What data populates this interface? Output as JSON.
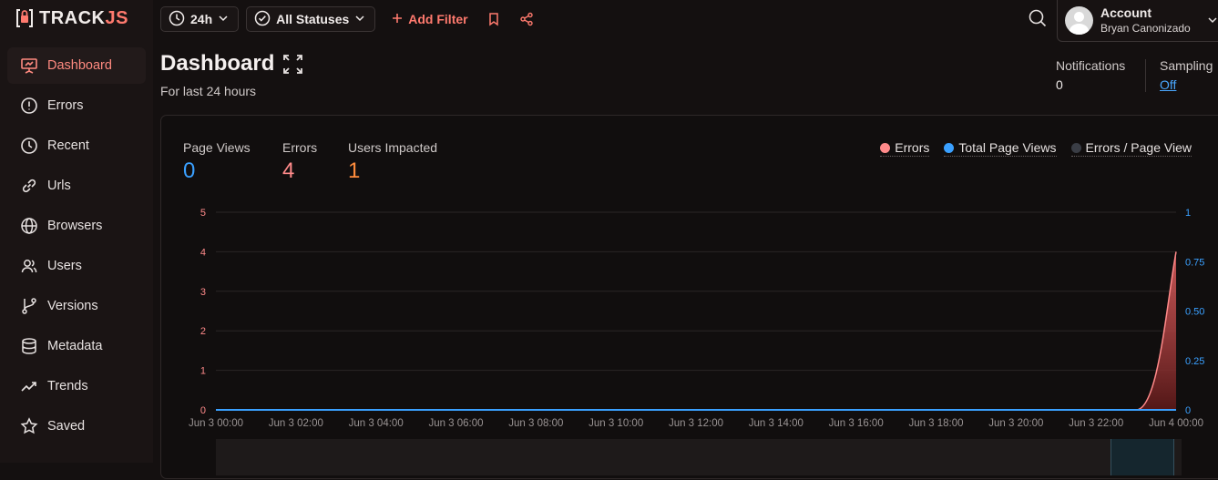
{
  "brand": {
    "track": "TRACK",
    "js": "JS"
  },
  "sidebar": {
    "items": [
      {
        "label": "Dashboard",
        "icon": "presentation-icon",
        "active": true
      },
      {
        "label": "Errors",
        "icon": "alert-circle-icon"
      },
      {
        "label": "Recent",
        "icon": "clock-icon"
      },
      {
        "label": "Urls",
        "icon": "link-icon"
      },
      {
        "label": "Browsers",
        "icon": "globe-icon"
      },
      {
        "label": "Users",
        "icon": "users-icon"
      },
      {
        "label": "Versions",
        "icon": "git-branch-icon"
      },
      {
        "label": "Metadata",
        "icon": "database-icon"
      },
      {
        "label": "Trends",
        "icon": "trend-icon"
      },
      {
        "label": "Saved",
        "icon": "star-icon"
      }
    ]
  },
  "toolbar": {
    "time_range": "24h",
    "status_filter": "All Statuses",
    "add_filter": "Add Filter"
  },
  "account": {
    "title": "Account",
    "name": "Bryan Canonizado"
  },
  "header": {
    "title": "Dashboard",
    "subtitle": "For last 24 hours",
    "notifications_label": "Notifications",
    "notifications_value": "0",
    "sampling_label": "Sampling",
    "sampling_value": "Off"
  },
  "stats": [
    {
      "label": "Page Views",
      "value": "0",
      "color": "#3aa0ff"
    },
    {
      "label": "Errors",
      "value": "4",
      "color": "#ff8a8a"
    },
    {
      "label": "Users Impacted",
      "value": "1",
      "color": "#ff8c3c"
    }
  ],
  "legend": [
    {
      "label": "Errors",
      "color": "#ff8a8a"
    },
    {
      "label": "Total Page Views",
      "color": "#3aa0ff"
    },
    {
      "label": "Errors / Page View",
      "color": "#3a3d45"
    }
  ],
  "chart_data": {
    "type": "area",
    "x": [
      "Jun 3 00:00",
      "Jun 3 02:00",
      "Jun 3 04:00",
      "Jun 3 06:00",
      "Jun 3 08:00",
      "Jun 3 10:00",
      "Jun 3 12:00",
      "Jun 3 14:00",
      "Jun 3 16:00",
      "Jun 3 18:00",
      "Jun 3 20:00",
      "Jun 3 22:00",
      "Jun 4 00:00"
    ],
    "series": [
      {
        "name": "Errors",
        "axis": "left",
        "values": [
          0,
          0,
          0,
          0,
          0,
          0,
          0,
          0,
          0,
          0,
          0,
          0,
          4
        ]
      },
      {
        "name": "Total Page Views",
        "axis": "right",
        "values": [
          0,
          0,
          0,
          0,
          0,
          0,
          0,
          0,
          0,
          0,
          0,
          0,
          0
        ]
      }
    ],
    "y_left": {
      "ylim": [
        0,
        5
      ],
      "ticks": [
        "0",
        "1",
        "2",
        "3",
        "4",
        "5"
      ]
    },
    "y_right": {
      "ylim": [
        0,
        1
      ],
      "ticks": [
        "0",
        "0.25",
        "0.50",
        "0.75",
        "1"
      ]
    },
    "grid": true,
    "legend_position": "top-right"
  }
}
